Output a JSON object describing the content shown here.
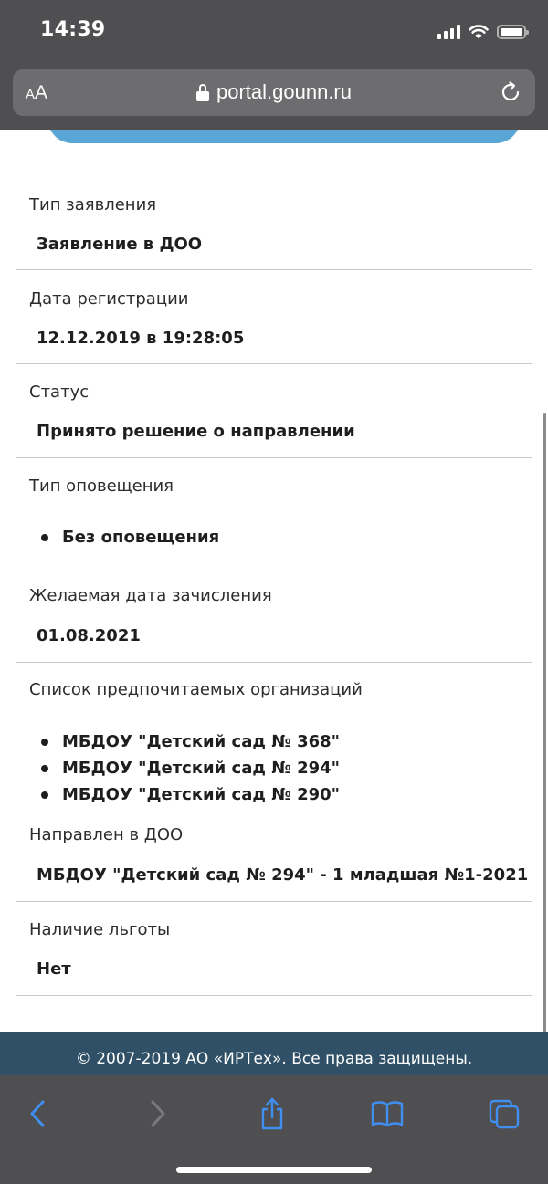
{
  "status_bar": {
    "time": "14:39",
    "icons": [
      "cellular-signal-icon",
      "wifi-icon",
      "battery-icon"
    ]
  },
  "address_bar": {
    "text_size_small": "A",
    "text_size_big": "A",
    "url": "portal.gounn.ru",
    "icons": [
      "lock-icon",
      "reload-icon"
    ]
  },
  "application": {
    "fields": [
      {
        "label": "Тип заявления",
        "value": "Заявление в ДОО"
      },
      {
        "label": "Дата регистрации",
        "value": "12.12.2019 в 19:28:05"
      },
      {
        "label": "Статус",
        "value": "Принято решение о направлении"
      },
      {
        "label": "Тип оповещения",
        "values": [
          "Без оповещения"
        ]
      },
      {
        "label": "Желаемая дата зачисления",
        "value": "01.08.2021"
      },
      {
        "label": "Список предпочитаемых организаций",
        "values": [
          "МБДОУ \"Детский сад № 368\"",
          "МБДОУ \"Детский сад № 294\"",
          "МБДОУ \"Детский сад № 290\""
        ]
      },
      {
        "label": "Направлен в ДОО",
        "value": "МБДОУ \"Детский сад № 294\" - 1 младшая №1-2021"
      },
      {
        "label": "Наличие льготы",
        "value": "Нет"
      }
    ]
  },
  "footer": {
    "copyright": "© 2007-2019 АО «ИРТех». Все права защищены."
  },
  "toolbar": {
    "buttons": [
      "back-icon",
      "forward-icon",
      "share-icon",
      "bookmarks-icon",
      "tabs-icon"
    ]
  },
  "colors": {
    "browser_chrome": "#4f4f51",
    "address_bar": "#6d6d70",
    "accent_blue": "#5aa6d6",
    "footer": "#2f5066",
    "toolbar_icon": "#3f8ef0",
    "toolbar_icon_disabled": "#7a7a7c"
  }
}
